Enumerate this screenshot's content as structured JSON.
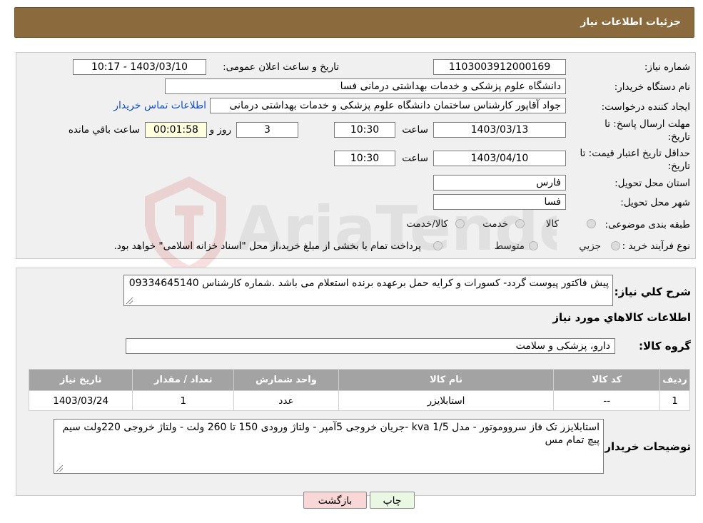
{
  "header": {
    "title": "جزئیات اطلاعات نیاز"
  },
  "form": {
    "need_number_label": "شماره نیاز:",
    "need_number": "1103003912000169",
    "announce_label": "تاریخ و ساعت اعلان عمومی:",
    "announce_value": "1403/03/10 - 10:17",
    "buyer_org_label": "نام دستگاه خریدار:",
    "buyer_org": "دانشگاه علوم پزشکی و خدمات بهداشتی درمانی فسا",
    "requester_label": "ایجاد کننده درخواست:",
    "requester": "جواد آقاپور کارشناس ساختمان دانشگاه علوم پزشکی و خدمات بهداشتی درمانی",
    "contact_link": "اطلاعات تماس خریدار",
    "deadline_label_1": "مهلت ارسال پاسخ: تا",
    "deadline_label_2": "تاریخ:",
    "deadline_date": "1403/03/13",
    "time_label": "ساعت",
    "deadline_time": "10:30",
    "days_value": "3",
    "days_label": "روز و",
    "remaining_time": "00:01:58",
    "remaining_label": "ساعت باقي مانده",
    "validity_label_1": "حداقل تاریخ اعتبار قیمت: تا",
    "validity_label_2": "تاریخ:",
    "validity_date": "1403/04/10",
    "validity_time": "10:30",
    "province_label": "استان محل تحویل:",
    "province": "فارس",
    "city_label": "شهر محل تحویل:",
    "city": "فسا",
    "category_label": "طبقه بندی موضوعی:",
    "category_options": [
      "کالا",
      "خدمت",
      "کالا/خدمت"
    ],
    "process_label": "نوع فرآیند خرید :",
    "process_options": [
      "جزيي",
      "متوسط"
    ],
    "process_note": "پرداخت تمام یا بخشی از مبلغ خرید،از محل \"اسناد خزانه اسلامی\" خواهد بود."
  },
  "description": {
    "label": "شرح کلي نیاز:",
    "text": "پیش فاکتور پیوست گردد- کسورات و کرایه حمل برعهده برنده استعلام می باشد .شماره کارشناس 09334645140"
  },
  "items_section": {
    "title": "اطلاعات کالاهاي مورد نیاز",
    "group_label": "گروه کالا:",
    "group_value": "دارو، پزشکی و سلامت",
    "columns": [
      "ردیف",
      "کد کالا",
      "نام کالا",
      "واحد شمارش",
      "تعداد / مقدار",
      "تاریخ نیاز"
    ],
    "rows": [
      {
        "row": "1",
        "code": "--",
        "name": "استابلایزر",
        "unit": "عدد",
        "qty": "1",
        "date": "1403/03/24"
      }
    ]
  },
  "buyer_notes": {
    "label": "توضیحات خریدار:",
    "text": "استابلایزر تک فاز سرووموتور - مدل kva 1/5 -جریان خروجی 5آمپر -  ولتاژ ورودی  150 تا 260 ولت  - ولتاژ خروجی 220ولت سیم پیچ تمام مس"
  },
  "buttons": {
    "print": "چاپ",
    "back": "بازگشت"
  },
  "watermark_text": "AriaTender.neT",
  "colors": {
    "header": "#8b6a3d",
    "link": "#1550c9",
    "back_button": "#f9d7d7",
    "print_button": "#e9f7e3"
  }
}
